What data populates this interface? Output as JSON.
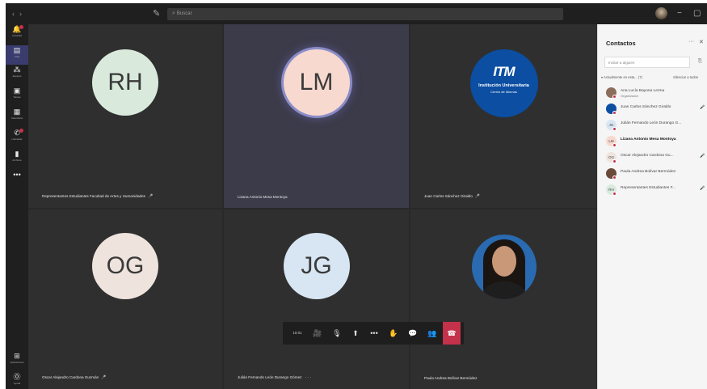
{
  "titlebar": {
    "back_icon": "chevron-left-icon",
    "forward_icon": "chevron-right-icon",
    "compose_icon": "compose-icon",
    "search_placeholder": "Buscar",
    "window_controls": [
      "−",
      "▢",
      "✕"
    ]
  },
  "rail": {
    "items": [
      {
        "label": "Actividad",
        "icon": "bell-icon",
        "glyph": "🔔",
        "badge": true
      },
      {
        "label": "Chat",
        "icon": "chat-icon",
        "glyph": "▤",
        "active": true
      },
      {
        "label": "Equipos",
        "icon": "teams-icon",
        "glyph": "⁂"
      },
      {
        "label": "Tareas",
        "icon": "backpack-icon",
        "glyph": "▣"
      },
      {
        "label": "Calendario",
        "icon": "calendar-icon",
        "glyph": "▦"
      },
      {
        "label": "Llamadas",
        "icon": "phone-icon",
        "glyph": "✆",
        "badge": true
      },
      {
        "label": "Archivos",
        "icon": "file-icon",
        "glyph": "▮"
      },
      {
        "label": "",
        "icon": "more-icon",
        "glyph": "•••"
      }
    ],
    "bottom": [
      {
        "label": "Aplicaciones",
        "icon": "apps-icon",
        "glyph": "⊞"
      },
      {
        "label": "Ayuda",
        "icon": "help-icon",
        "glyph": "⓪"
      }
    ]
  },
  "tiles": [
    {
      "initials": "RH",
      "name": "Representantes Estudiantes Facultad de Artes y Humanidades",
      "bg": "#d9eadd",
      "mic": "🎤"
    },
    {
      "initials": "LM",
      "name": "Lizana Antonio Mesa Montoya",
      "bg": "#f7d9cf",
      "highlight": true
    },
    {
      "type": "logo",
      "name": "Juan Carlos Sánchez Giraldo",
      "logo_text": "ITM",
      "logo_line1": "Institución Universitaria",
      "logo_line2": "Centro de Idiomas",
      "mic": "🎤"
    },
    {
      "initials": "OG",
      "name": "Oscar Alejandro Cardona Guzmán",
      "bg": "#efe3dd",
      "mic": "🎤"
    },
    {
      "initials": "JG",
      "name": "Julián Fernando León Durango Gómez",
      "bg": "#d7e6f2",
      "suffix": "· · ·"
    },
    {
      "type": "photo",
      "name": "Paula Andrea Bolívar Bermúdez"
    }
  ],
  "callbar": {
    "time": "16:01",
    "buttons": [
      {
        "icon": "camera-off-icon",
        "glyph": "🎥"
      },
      {
        "icon": "mic-icon",
        "glyph": "🎙"
      },
      {
        "icon": "share-screen-icon",
        "glyph": "⬆"
      },
      {
        "icon": "more-options-icon",
        "glyph": "•••"
      },
      {
        "icon": "raise-hand-icon",
        "glyph": "✋"
      },
      {
        "icon": "chat-bubble-icon",
        "glyph": "💬"
      },
      {
        "icon": "participants-icon",
        "glyph": "👥"
      },
      {
        "icon": "hang-up-icon",
        "glyph": "☎"
      }
    ]
  },
  "panel": {
    "title": "Contactos",
    "more": "···",
    "close": "✕",
    "invite_placeholder": "Invitar a alguien",
    "section_label": "▾ Actualmente en esta... (7)",
    "mute_all": "Silenciar a todos",
    "people": [
      {
        "name": "Ana Lucía Bayona Lerma",
        "role": "Organizador",
        "initials": "",
        "bg": "#8a6d5a"
      },
      {
        "name": "Juan Carlos Sánchez Giraldo",
        "initials": "",
        "bg": "#0b4ea2",
        "mic": "🎤"
      },
      {
        "name": "Julián Fernando León Durango G...",
        "initials": "JG",
        "bg": "#d7e6f2"
      },
      {
        "name": "Lizana Antonio Mesa Montoya",
        "initials": "LM",
        "bg": "#f7d9cf",
        "bold": true
      },
      {
        "name": "Oscar Alejandro Cardona Gu...",
        "initials": "OG",
        "bg": "#efe3dd",
        "mic": "🎤"
      },
      {
        "name": "Paula Andrea Bolívar Bermúdez",
        "initials": "",
        "bg": "#6b4a3a"
      },
      {
        "name": "Representantes Estudiantes F...",
        "initials": "RH",
        "bg": "#d9eadd",
        "mic": "🎤"
      }
    ]
  },
  "colors": {
    "accent": "#6264a7",
    "hangup": "#c4314b",
    "stage": "#292929",
    "tile": "#2f2f2f"
  }
}
